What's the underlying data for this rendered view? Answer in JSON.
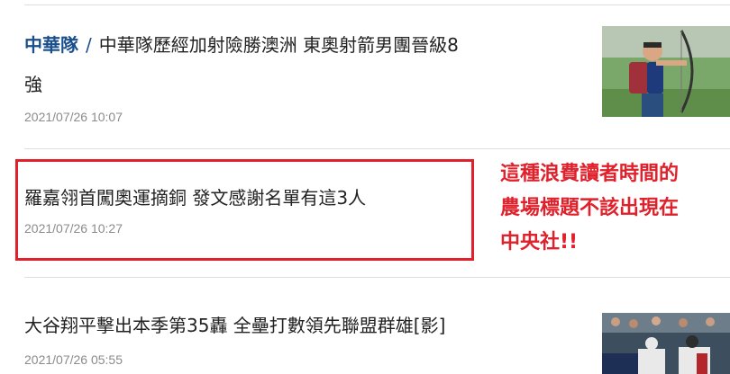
{
  "articles": [
    {
      "tag": "中華隊",
      "separator": "/",
      "title_line1": "中華隊歷經加射險勝澳洲 東奧射箭男團晉級8",
      "title_line2": "強",
      "date": "2021/07/26 10:07",
      "thumb": "archery-photo"
    },
    {
      "title": "羅嘉翎首闖奧運摘銅 發文感謝名單有這3人",
      "date": "2021/07/26 10:27"
    },
    {
      "title": "大谷翔平擊出本季第35轟 全壘打數領先聯盟群雄[影]",
      "date": "2021/07/26 05:55",
      "thumb": "baseball-photo"
    }
  ],
  "annotation": {
    "lines": [
      "這種浪費讀者時間的",
      "農場標題不該出現在",
      "中央社!!"
    ],
    "color": "#e0202a"
  },
  "colors": {
    "tag": "#1a4f8b",
    "divider": "#dedede",
    "date": "#8b8b8b"
  }
}
